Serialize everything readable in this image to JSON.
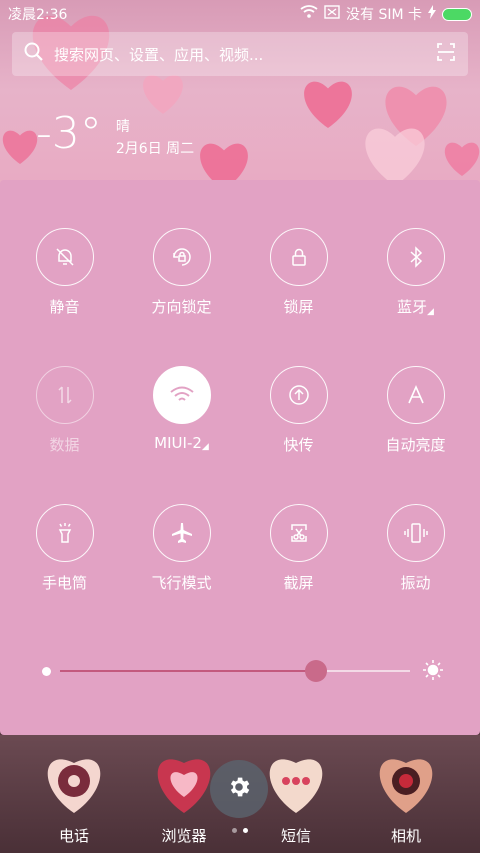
{
  "status": {
    "time": "凌晨2:36",
    "sim": "没有 SIM 卡"
  },
  "search": {
    "placeholder": "搜索网页、设置、应用、视频..."
  },
  "weather": {
    "temp": "-3°",
    "condition": "晴",
    "date": "2月6日 周二"
  },
  "toggles": [
    {
      "label": "静音",
      "icon": "bell-off-icon"
    },
    {
      "label": "方向锁定",
      "icon": "rotation-lock-icon"
    },
    {
      "label": "锁屏",
      "icon": "lock-icon"
    },
    {
      "label": "蓝牙",
      "icon": "bluetooth-icon"
    },
    {
      "label": "数据",
      "icon": "data-arrows-icon"
    },
    {
      "label": "MIUI-2",
      "icon": "wifi-icon"
    },
    {
      "label": "快传",
      "icon": "upload-circle-icon"
    },
    {
      "label": "自动亮度",
      "icon": "auto-brightness-icon"
    },
    {
      "label": "手电筒",
      "icon": "flashlight-icon"
    },
    {
      "label": "飞行模式",
      "icon": "airplane-icon"
    },
    {
      "label": "截屏",
      "icon": "screenshot-scissors-icon"
    },
    {
      "label": "振动",
      "icon": "vibrate-icon"
    }
  ],
  "brightness": {
    "level": 0.73
  },
  "dock": [
    {
      "name": "电话"
    },
    {
      "name": "浏览器"
    },
    {
      "name": "短信"
    },
    {
      "name": "相机"
    }
  ],
  "colors": {
    "panel": "#e2a2c4",
    "accent": "#c96a8a"
  }
}
